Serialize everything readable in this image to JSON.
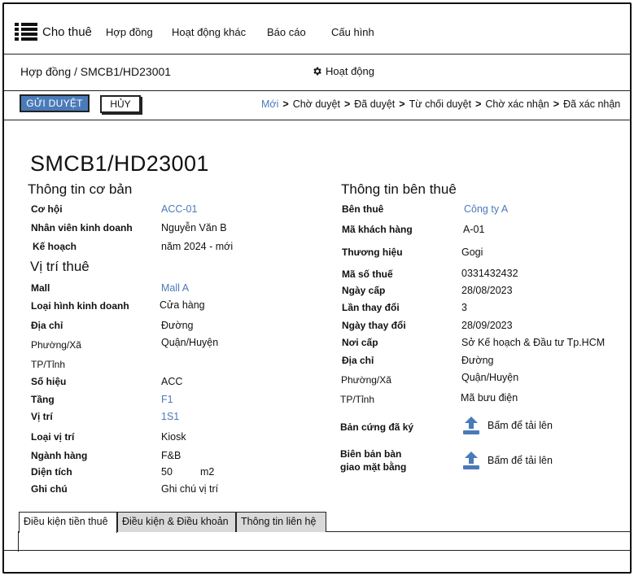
{
  "nav": {
    "app_title": "Cho thuê",
    "items": [
      "Hợp đồng",
      "Hoạt động khác",
      "Báo cáo",
      "Cấu hình"
    ]
  },
  "breadcrumb": "Hợp đồng / SMCB1/HD23001",
  "activity_label": "Hoạt động",
  "actions": {
    "submit_label": "GỬI DUYỆT",
    "cancel_label": "HỦY"
  },
  "status_steps": [
    "Mới",
    "Chờ duyệt",
    "Đã duyệt",
    "Từ chối duyệt",
    "Chờ xác nhận",
    "Đã xác nhận"
  ],
  "colors": {
    "accent": "#4a7ab8",
    "tab_inactive": "#d9d9d9"
  },
  "doc_title": "SMCB1/HD23001",
  "basic_info": {
    "heading": "Thông tin cơ bản",
    "opportunity_label": "Cơ hội",
    "opportunity": "ACC-01",
    "sales_staff_label": "Nhân viên kinh doanh",
    "sales_staff": "Nguyễn Văn B",
    "plan_label": "Kế hoạch",
    "plan": "năm 2024 - mới"
  },
  "location": {
    "heading": "Vị trí thuê",
    "mall_label": "Mall",
    "mall": "Mall A",
    "business_type_label": "Loại hình kinh doanh",
    "business_type": "Cửa hàng",
    "address_label": "Địa chỉ",
    "street": "Đường",
    "ward": "Phường/Xã",
    "district": "Quận/Huyện",
    "city": "TP/Tỉnh",
    "number_label": "Số hiệu",
    "number": "ACC",
    "floor_label": "Tầng",
    "floor": "F1",
    "position_label": "Vị trí",
    "position": "1S1",
    "position_type_label": "Loại vị trí",
    "position_type": "Kiosk",
    "category_label": "Ngành hàng",
    "category": "F&B",
    "area_label": "Diện tích",
    "area": "50",
    "area_unit": "m2",
    "note_label": "Ghi chú",
    "note": "Ghi chú vị trí"
  },
  "tenant": {
    "heading": "Thông tin bên thuê",
    "tenant_label": "Bên thuê",
    "tenant": "Công ty A",
    "customer_code_label": "Mã khách hàng",
    "customer_code": "A-01",
    "brand_label": "Thương hiệu",
    "brand": "Gogi",
    "tax_code_label": "Mã số thuế",
    "tax_code": "0331432432",
    "issue_date_label": "Ngày cấp",
    "issue_date": "28/08/2023",
    "change_count_label": "Lần thay đổi",
    "change_count": "3",
    "change_date_label": "Ngày thay đổi",
    "change_date": "28/09/2023",
    "issued_by_label": "Nơi cấp",
    "issued_by": "Sở Kế hoạch & Đầu tư Tp.HCM",
    "address_label": "Địa chỉ",
    "street": "Đường",
    "ward": "Phường/Xã",
    "district": "Quận/Huyện",
    "city": "TP/Tỉnh",
    "postal_code": "Mã bưu điện",
    "signed_copy_label": "Bản cứng đã ký",
    "handover_label_1": "Biên bản bàn",
    "handover_label_2": "giao mặt bằng",
    "upload_label": "Bấm để tải lên"
  },
  "tabs": [
    "Điều kiện tiền thuê",
    "Điều kiện & Điều khoản",
    "Thông tin liên hệ"
  ]
}
